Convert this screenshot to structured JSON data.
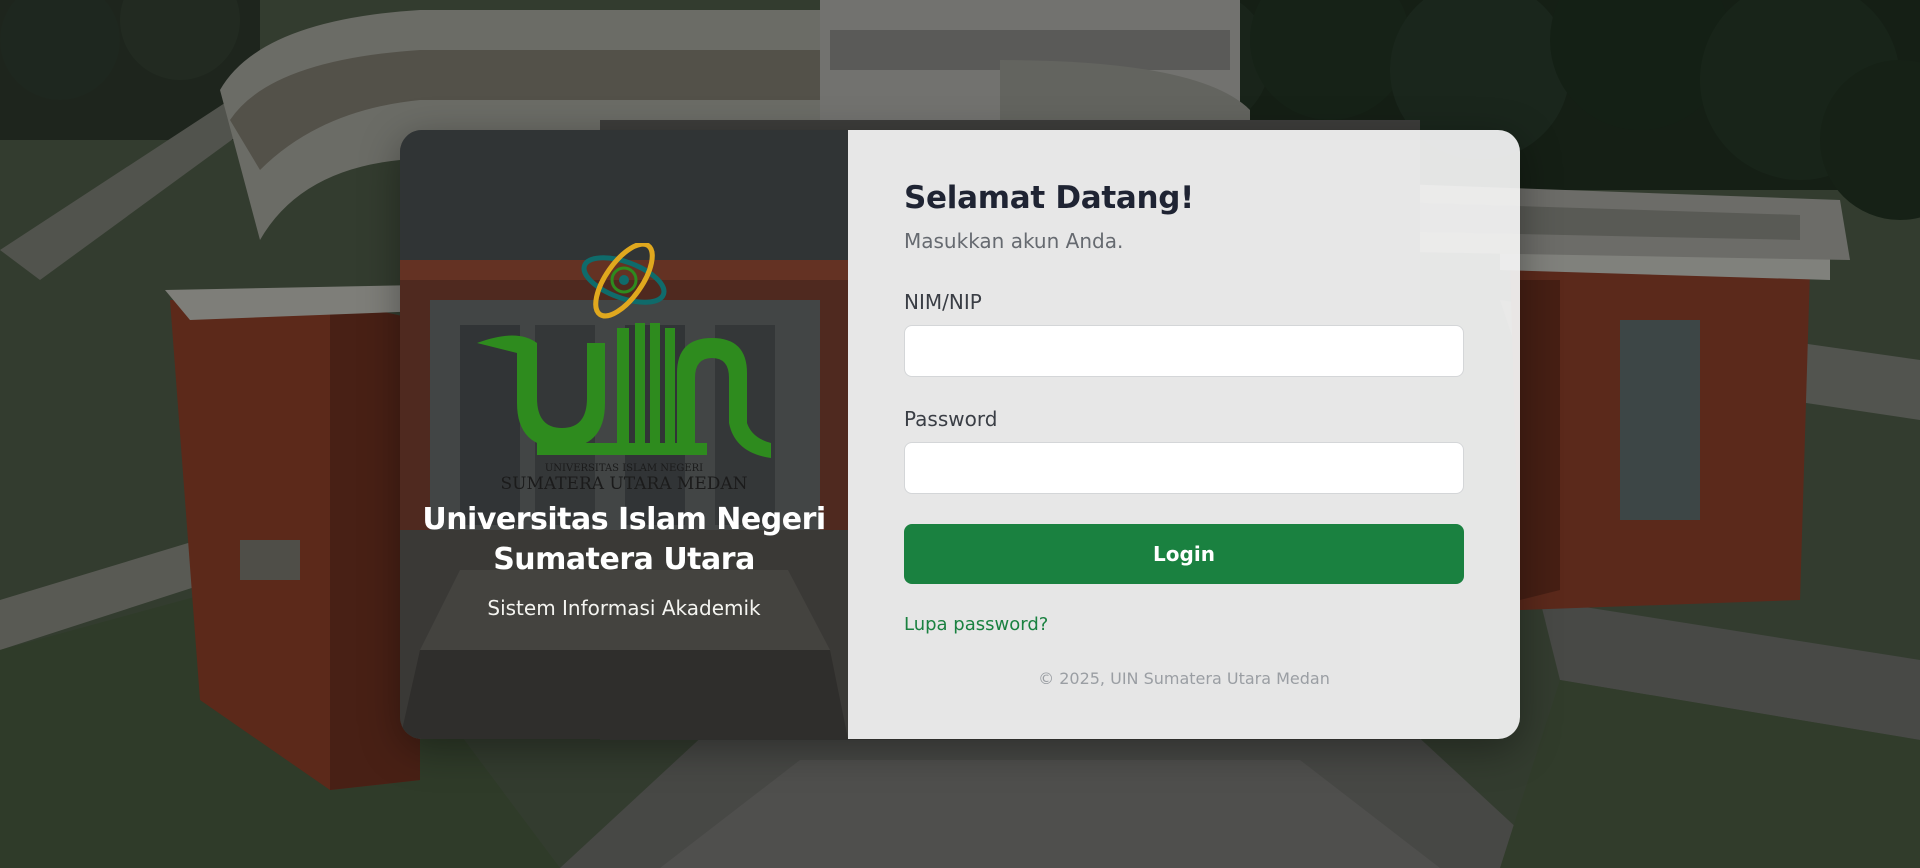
{
  "branding": {
    "logo_text_top": "UNIVERSITAS ISLAM NEGERI",
    "logo_text_bottom": "SUMATERA UTARA MEDAN",
    "university_name_line1": "Universitas Islam Negeri",
    "university_name_line2": "Sumatera Utara",
    "system_name": "Sistem Informasi Akademik"
  },
  "login": {
    "title": "Selamat Datang!",
    "subtitle": "Masukkan akun Anda.",
    "nim_label": "NIM/NIP",
    "nim_value": "",
    "password_label": "Password",
    "password_value": "",
    "login_button": "Login",
    "forgot_link": "Lupa password?",
    "footer": "© 2025, UIN Sumatera Utara Medan"
  },
  "colors": {
    "brand_green": "#1a8140",
    "logo_green": "#2e8b1e",
    "logo_gold": "#e0a81e",
    "logo_teal": "#0f6b6b"
  },
  "icons": {
    "logo": "uin-logo-icon",
    "atom": "atom-orbit-icon"
  }
}
